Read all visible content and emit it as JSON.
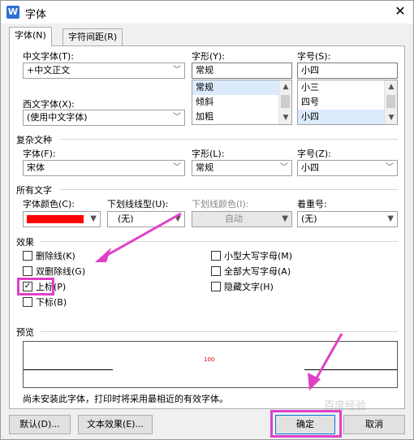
{
  "window": {
    "title": "字体",
    "app_icon": "W",
    "close": "✕"
  },
  "tabs": [
    {
      "label": "字体(N)"
    },
    {
      "label": "字符间距(R)"
    }
  ],
  "chinese_font": {
    "label": "中文字体(T):",
    "value": "+中文正文"
  },
  "style": {
    "label": "字形(Y):",
    "value": "常规",
    "options": [
      "常规",
      "倾斜",
      "加粗"
    ]
  },
  "size": {
    "label": "字号(S):",
    "value": "小四",
    "options": [
      "小三",
      "四号",
      "小四"
    ]
  },
  "western_font": {
    "label": "西文字体(X):",
    "value": "(使用中文字体)"
  },
  "complex": {
    "section": "复杂文种",
    "font_label": "字体(F):",
    "font_value": "宋体",
    "style_label": "字形(L):",
    "style_value": "常规",
    "size_label": "字号(Z):",
    "size_value": "小四"
  },
  "all_text": {
    "section": "所有文字",
    "color_label": "字体颜色(C):",
    "color_value": "#ff0000",
    "underline_label": "下划线线型(U):",
    "underline_value": "(无)",
    "underline_color_label": "下划线颜色(I):",
    "underline_color_value": "自动",
    "emphasis_label": "着重号:",
    "emphasis_value": "(无)"
  },
  "effects": {
    "section": "效果",
    "left": [
      {
        "label": "删除线(K)",
        "checked": false
      },
      {
        "label": "双删除线(G)",
        "checked": false
      },
      {
        "label": "上标(P)",
        "checked": true
      },
      {
        "label": "下标(B)",
        "checked": false
      }
    ],
    "right": [
      {
        "label": "小型大写字母(M)",
        "checked": false
      },
      {
        "label": "全部大写字母(A)",
        "checked": false
      },
      {
        "label": "隐藏文字(H)",
        "checked": false
      }
    ]
  },
  "preview": {
    "section": "预览",
    "sample": "100",
    "note": "尚未安装此字体，打印时将采用最相近的有效字体。"
  },
  "buttons": {
    "default": "默认(D)...",
    "text_effect": "文本效果(E)...",
    "ok": "确定",
    "cancel": "取消"
  },
  "watermark": "百度经验"
}
